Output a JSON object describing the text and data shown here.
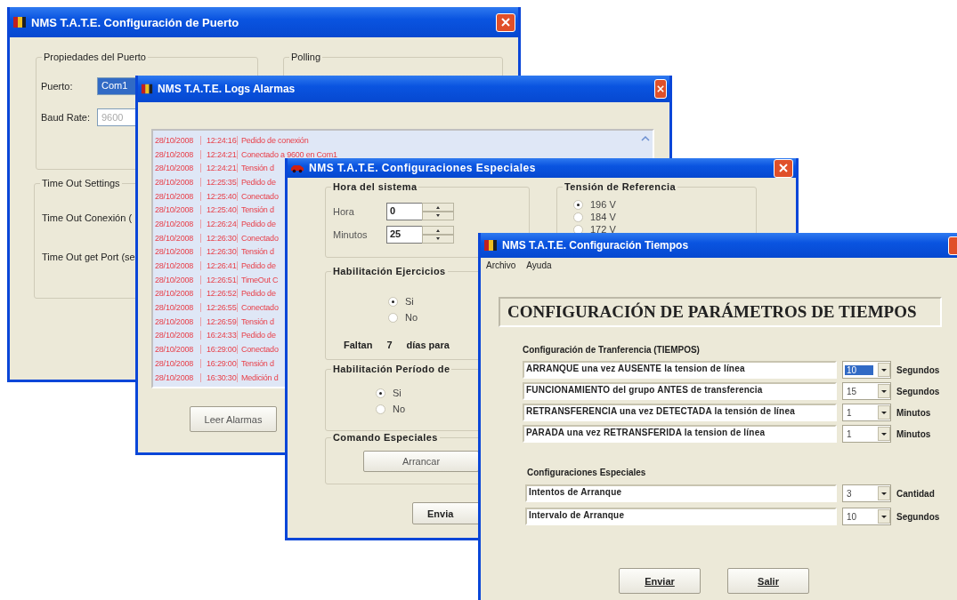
{
  "port_window": {
    "title": "NMS T.A.T.E. Configuración de Puerto",
    "port_group": {
      "legend": "Propiedades del Puerto",
      "port_label": "Puerto:",
      "port_value": "Com1",
      "baud_label": "Baud Rate:",
      "baud_value": "9600"
    },
    "polling_group": {
      "legend": "Polling"
    },
    "timeout_group": {
      "legend": "Time Out Settings",
      "labels": [
        "Time Out Conexión (",
        "Time Out get Port (se"
      ]
    }
  },
  "log_window": {
    "title": "NMS T.A.T.E. Logs Alarmas",
    "rows": [
      {
        "date": "28/10/2008",
        "time": "12:24:16",
        "message": "Pedido de conexión"
      },
      {
        "date": "28/10/2008",
        "time": "12:24:21",
        "message": "Conectado a 9600 en Com1"
      },
      {
        "date": "28/10/2008",
        "time": "12:24:21",
        "message": "Tensión d"
      },
      {
        "date": "28/10/2008",
        "time": "12:25:35",
        "message": "Pedido de"
      },
      {
        "date": "28/10/2008",
        "time": "12:25:40",
        "message": "Conectado"
      },
      {
        "date": "28/10/2008",
        "time": "12:25:40",
        "message": "Tensión d"
      },
      {
        "date": "28/10/2008",
        "time": "12:26:24",
        "message": "Pedido de"
      },
      {
        "date": "28/10/2008",
        "time": "12:26:30",
        "message": "Conectado"
      },
      {
        "date": "28/10/2008",
        "time": "12:26:30",
        "message": "Tensión d"
      },
      {
        "date": "28/10/2008",
        "time": "12:26:41",
        "message": "Pedido de"
      },
      {
        "date": "28/10/2008",
        "time": "12:26:51",
        "message": "TimeOut C"
      },
      {
        "date": "28/10/2008",
        "time": "12:26:52",
        "message": "Pedido de"
      },
      {
        "date": "28/10/2008",
        "time": "12:26:55",
        "message": "Conectado"
      },
      {
        "date": "28/10/2008",
        "time": "12:26:59",
        "message": "Tensión d"
      },
      {
        "date": "28/10/2008",
        "time": "16:24:33",
        "message": "Pedido de"
      },
      {
        "date": "28/10/2008",
        "time": "16:29:00",
        "message": "Conectado"
      },
      {
        "date": "28/10/2008",
        "time": "16:29:00",
        "message": "Tensión d"
      },
      {
        "date": "28/10/2008",
        "time": "16:30:30",
        "message": "Medición d"
      }
    ],
    "button": "Leer Alarmas"
  },
  "special_window": {
    "title": "NMS T.A.T.E. Configuraciones Especiales",
    "time_group": {
      "legend": "Hora del sistema",
      "fields": [
        {
          "label": "Hora",
          "value": "0"
        },
        {
          "label": "Minutos",
          "value": "25"
        }
      ]
    },
    "voltage_group": {
      "legend": "Tensión de Referencia",
      "options": [
        {
          "label": "196 V",
          "selected": true
        },
        {
          "label": "184 V",
          "selected": false
        },
        {
          "label": "172 V",
          "selected": false
        }
      ]
    },
    "exercise_group": {
      "legend": "Habilitación Ejercicios",
      "options": [
        {
          "label": "Si",
          "selected": true
        },
        {
          "label": "No",
          "selected": false
        }
      ],
      "remaining": [
        "Faltan",
        "7",
        "días para"
      ]
    },
    "period_group": {
      "legend": "Habilitación Período de",
      "options": [
        {
          "label": "Si",
          "selected": true
        },
        {
          "label": "No",
          "selected": false
        }
      ]
    },
    "command_group": {
      "legend": "Comando Especiales",
      "button": "Arrancar"
    },
    "send_button": "Envia"
  },
  "times_window": {
    "title": "NMS T.A.T.E. Configuración Tiempos",
    "menu": [
      "Archivo",
      "Ayuda"
    ],
    "heading": "CONFIGURACIÓN DE PARÁMETROS DE TIEMPOS",
    "transfer_label": "Configuración de Tranferencia (TIEMPOS)",
    "transfer_rows": [
      {
        "description": "ARRANQUE una vez AUSENTE la tension de línea",
        "value": "10",
        "unit": "Segundos",
        "focused": true
      },
      {
        "description": "FUNCIONAMIENTO del grupo ANTES de transferencia",
        "value": "15",
        "unit": "Segundos",
        "focused": false
      },
      {
        "description": "RETRANSFERENCIA una vez DETECTADA la tensión de línea",
        "value": "1",
        "unit": "Minutos",
        "focused": false
      },
      {
        "description": "PARADA una vez RETRANSFERIDA la tension de línea",
        "value": "1",
        "unit": "Minutos",
        "focused": false
      }
    ],
    "special_label": "Configuraciones Especiales",
    "special_rows": [
      {
        "description": "Intentos de Arranque",
        "value": "3",
        "unit": "Cantidad",
        "focused": false
      },
      {
        "description": "Intervalo de Arranque",
        "value": "10",
        "unit": "Segundos",
        "focused": false
      }
    ],
    "buttons": [
      "Enviar",
      "Salir"
    ]
  }
}
